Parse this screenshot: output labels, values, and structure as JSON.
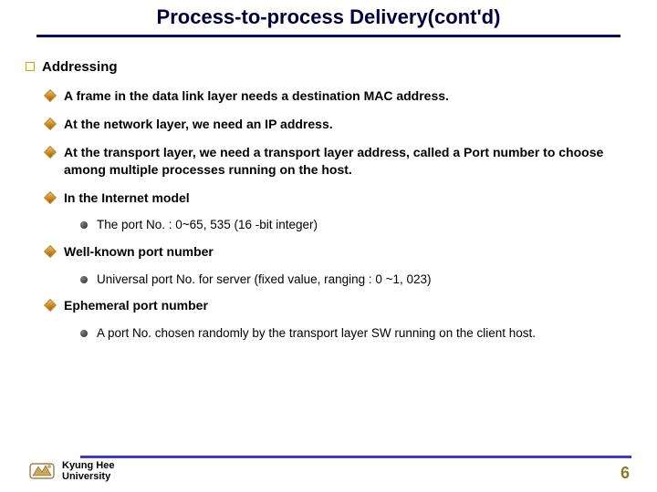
{
  "title": "Process-to-process Delivery(cont'd)",
  "heading": "Addressing",
  "bullets": {
    "b0": "A frame in the data link layer needs a destination MAC address.",
    "b1": "At the network layer, we need an IP address.",
    "b2": "At the transport layer, we need a transport layer address, called a Port number to choose among multiple processes running on the host.",
    "b3": "In the Internet model",
    "b3_sub0": "The port No.  :  0~65, 535  (16 -bit integer)",
    "b4": "Well-known port number",
    "b4_sub0": "Universal port No. for server  (fixed value, ranging : 0 ~1, 023)",
    "b5": "Ephemeral port number",
    "b5_sub0": "A port No. chosen randomly by the transport layer SW running on the client host."
  },
  "footer": {
    "university_line1": "Kyung Hee",
    "university_line2": "University",
    "page": "6"
  },
  "colors": {
    "title_underline": "#001060",
    "footer_line": "#3a3ad0",
    "page_no": "#8a7a2a"
  }
}
